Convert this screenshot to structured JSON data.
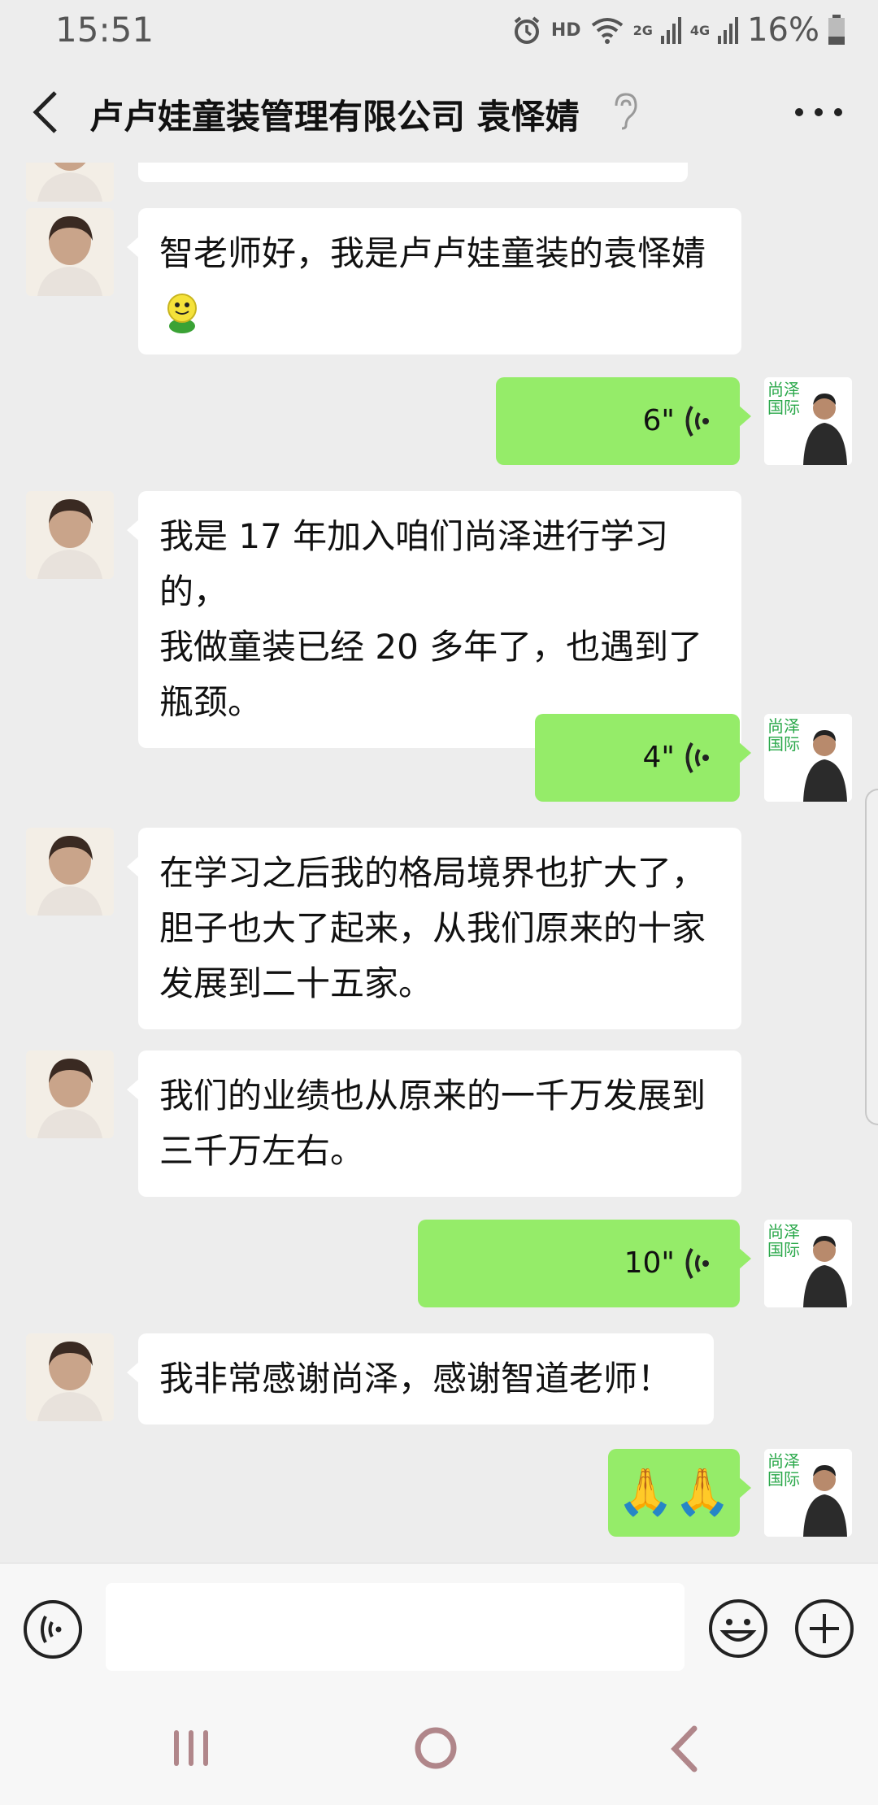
{
  "status_bar": {
    "time": "15:51",
    "hd": "HD",
    "net1": "2G",
    "net2": "4G",
    "battery": "16%"
  },
  "header": {
    "title": "卢卢娃童装管理有限公司 袁怿婧"
  },
  "messages": [
    {
      "side": "in",
      "text_line1": "智老师好，我是卢卢娃童装的袁怿婧"
    },
    {
      "side": "out",
      "voice": "6\""
    },
    {
      "side": "in",
      "text_line1": "我是 17 年加入咱们尚泽进行学习的，",
      "text_line2": "我做童装已经 20 多年了，也遇到了",
      "text_line3": "瓶颈。"
    },
    {
      "side": "out",
      "voice": "4\""
    },
    {
      "side": "in",
      "text_line1": "在学习之后我的格局境界也扩大了，",
      "text_line2": "胆子也大了起来，从我们原来的十家",
      "text_line3": "发展到二十五家。"
    },
    {
      "side": "in",
      "text_line1": "我们的业绩也从原来的一千万发展到",
      "text_line2": "三千万左右。"
    },
    {
      "side": "out",
      "voice": "10\""
    },
    {
      "side": "in",
      "text_line1": "我非常感谢尚泽，感谢智道老师！"
    },
    {
      "side": "out",
      "emoji": "🙏🙏"
    }
  ],
  "avatar_logo": "尚泽国际",
  "input": {
    "placeholder": ""
  },
  "colors": {
    "outgoing_bubble": "#95ec69",
    "incoming_bubble": "#ffffff",
    "background": "#ededed"
  }
}
